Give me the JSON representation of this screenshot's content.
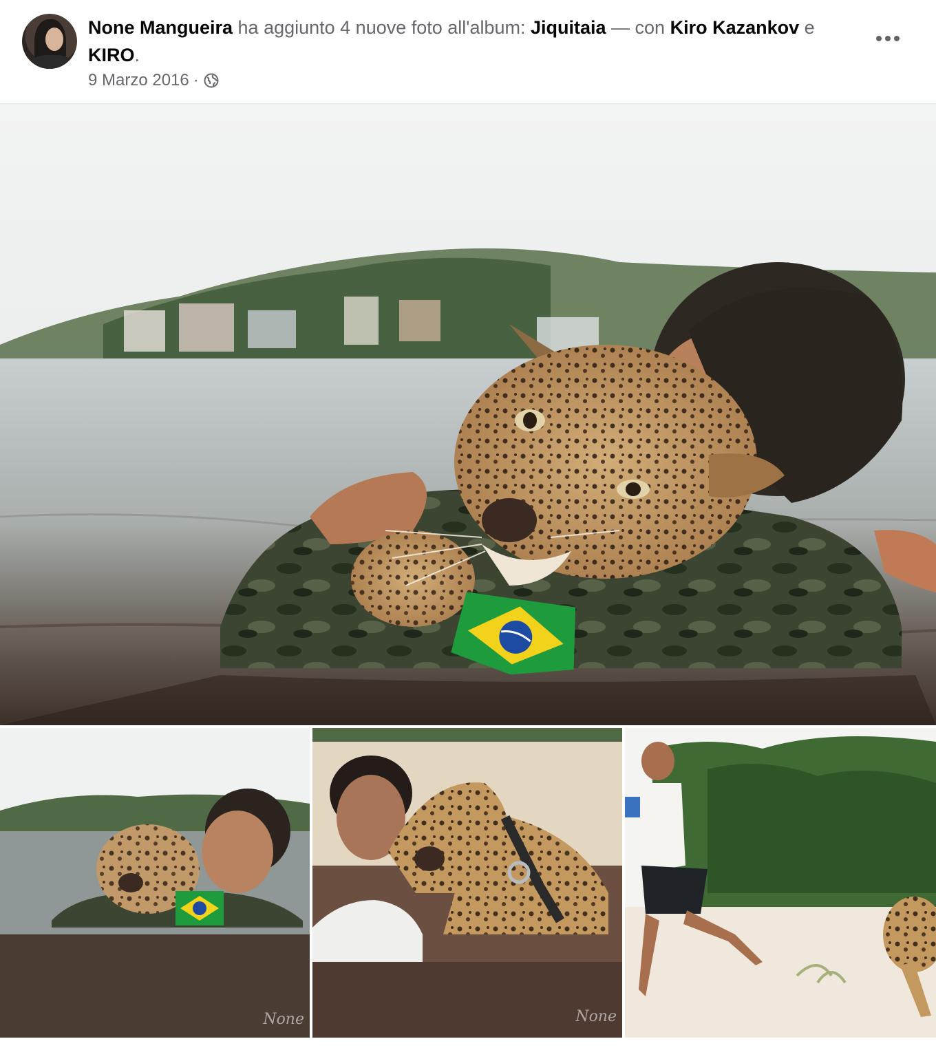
{
  "post": {
    "author": "None Mangueira",
    "action_text": " ha aggiunto 4 nuove foto all'album: ",
    "album_name": "Jiquitaia",
    "with_text": " — con ",
    "tagged_1": "Kiro Kazankov",
    "and_text": " e ",
    "tagged_2": "KIRO",
    "end_text": ".",
    "date": "9 Marzo 2016",
    "separator": "·",
    "privacy_icon": "globe-icon",
    "more_icon": "more-dots-icon"
  },
  "photos": {
    "main_alt": "Man in camouflage swimming in river holding jaguar cub with Brazil flag patch",
    "watermark_1": "None",
    "watermark_2": "None"
  }
}
